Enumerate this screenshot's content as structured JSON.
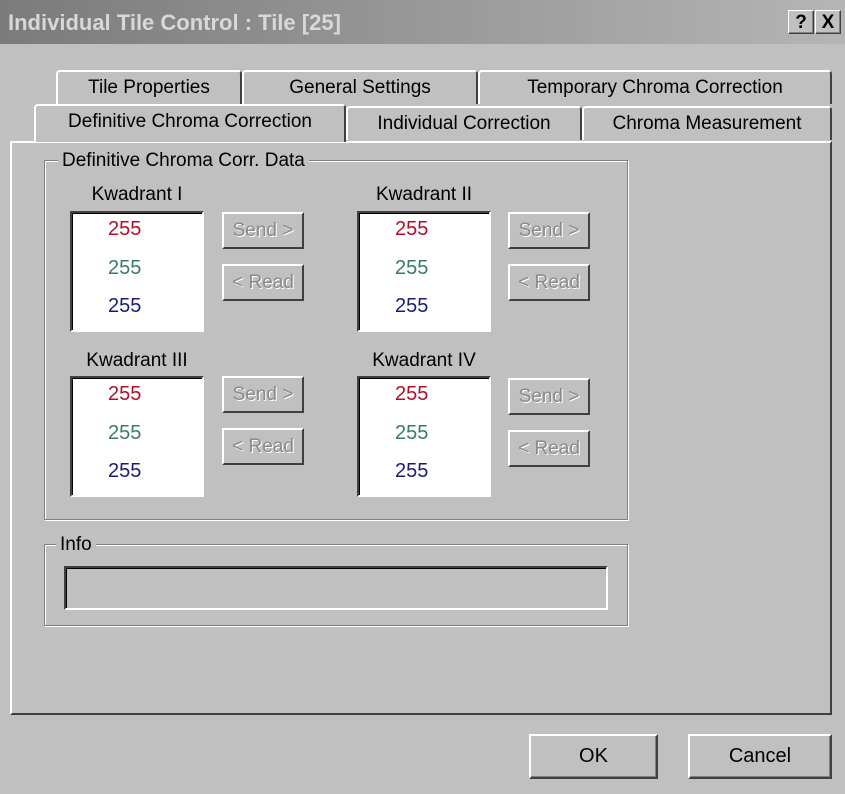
{
  "window": {
    "title": "Individual Tile Control : Tile [25]",
    "help_label": "?",
    "close_label": "X"
  },
  "tabs": {
    "row1": [
      "Tile Properties",
      "General Settings",
      "Temporary Chroma Correction"
    ],
    "row2": [
      "Definitive Chroma Correction",
      "Individual Correction",
      "Chroma Measurement"
    ],
    "active": "Definitive Chroma Correction"
  },
  "group": {
    "title": "Definitive Chroma Corr. Data",
    "quadrants": [
      {
        "label": "Kwadrant I",
        "values": [
          "255",
          "255",
          "255"
        ]
      },
      {
        "label": "Kwadrant II",
        "values": [
          "255",
          "255",
          "255"
        ]
      },
      {
        "label": "Kwadrant III",
        "values": [
          "255",
          "255",
          "255"
        ]
      },
      {
        "label": "Kwadrant IV",
        "values": [
          "255",
          "255",
          "255"
        ]
      }
    ],
    "send_label": "Send >",
    "read_label": "< Read"
  },
  "info": {
    "title": "Info",
    "value": ""
  },
  "footer": {
    "ok_label": "OK",
    "cancel_label": "Cancel"
  },
  "colors": {
    "red_value": "#b0102a",
    "green_value": "#3a7a6a",
    "blue_value": "#1a1a7a"
  }
}
